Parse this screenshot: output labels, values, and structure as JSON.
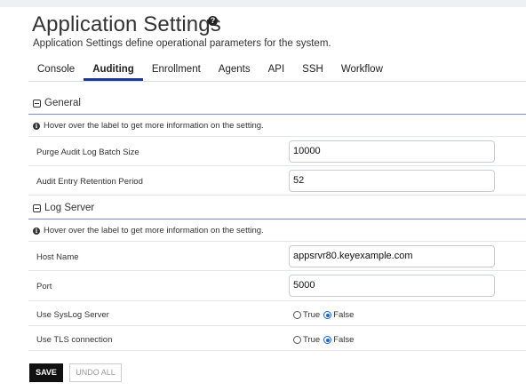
{
  "header": {
    "title": "Application Settings",
    "help_icon": "question-circle-icon",
    "description": "Application Settings define operational parameters for the system."
  },
  "tabs": [
    {
      "label": "Console",
      "active": false
    },
    {
      "label": "Auditing",
      "active": true
    },
    {
      "label": "Enrollment",
      "active": false
    },
    {
      "label": "Agents",
      "active": false
    },
    {
      "label": "API",
      "active": false
    },
    {
      "label": "SSH",
      "active": false
    },
    {
      "label": "Workflow",
      "active": false
    }
  ],
  "general": {
    "title": "General",
    "info": "Hover over the label to get more information on the setting.",
    "purge_batch_label": "Purge Audit Log Batch Size",
    "purge_batch_value": "10000",
    "retention_label": "Audit Entry Retention Period",
    "retention_value": "52"
  },
  "log_server": {
    "title": "Log Server",
    "info": "Hover over the label to get more information on the setting.",
    "host_label": "Host Name",
    "host_value": "appsrvr80.keyexample.com",
    "port_label": "Port",
    "port_value": "5000",
    "syslog_label": "Use SysLog Server",
    "syslog_true": "True",
    "syslog_false": "False",
    "syslog_selected": "False",
    "tls_label": "Use TLS connection",
    "tls_true": "True",
    "tls_false": "False",
    "tls_selected": "False"
  },
  "footer": {
    "save_label": "SAVE",
    "undo_label": "UNDO ALL"
  },
  "colors": {
    "active_tab_underline": "#1f3a93",
    "section_rule": "#7f88c8",
    "radio_selected": "#1b64d8",
    "save_button_bg": "#111111"
  }
}
